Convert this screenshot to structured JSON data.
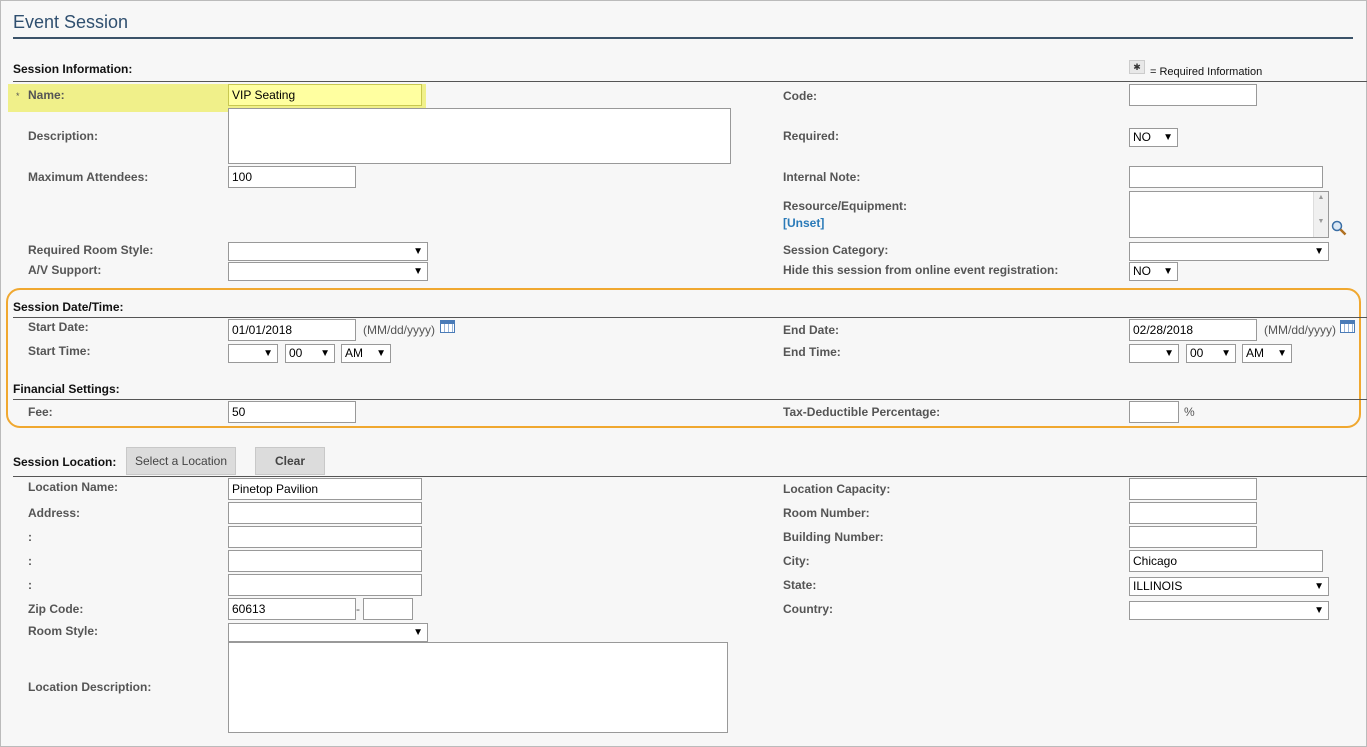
{
  "page": {
    "title": "Event Session"
  },
  "legend": {
    "text": "= Required Information",
    "icon": "required-asterisk-icon"
  },
  "session_info": {
    "heading": "Session Information:",
    "name": {
      "label": "Name:",
      "value": "VIP Seating",
      "required_mark": "*"
    },
    "description": {
      "label": "Description:",
      "value": ""
    },
    "max_attendees": {
      "label": "Maximum Attendees:",
      "value": "100"
    },
    "room_style": {
      "label": "Required Room Style:",
      "value": ""
    },
    "av_support": {
      "label": "A/V Support:",
      "value": ""
    },
    "code": {
      "label": "Code:",
      "value": ""
    },
    "required": {
      "label": "Required:",
      "value": "NO"
    },
    "internal_note": {
      "label": "Internal Note:",
      "value": ""
    },
    "resource": {
      "label": "Resource/Equipment:",
      "link": "[Unset]"
    },
    "category": {
      "label": "Session Category:",
      "value": ""
    },
    "hide": {
      "label": "Hide this session from online event registration:",
      "value": "NO"
    }
  },
  "datetime": {
    "heading": "Session Date/Time:",
    "start_date": {
      "label": "Start Date:",
      "value": "01/01/2018",
      "hint": "(MM/dd/yyyy)"
    },
    "start_time": {
      "label": "Start Time:",
      "hour": "",
      "minute": "00",
      "ampm": "AM"
    },
    "end_date": {
      "label": "End Date:",
      "value": "02/28/2018",
      "hint": "(MM/dd/yyyy)"
    },
    "end_time": {
      "label": "End Time:",
      "hour": "",
      "minute": "00",
      "ampm": "AM"
    }
  },
  "financial": {
    "heading": "Financial Settings:",
    "fee": {
      "label": "Fee:",
      "value": "50"
    },
    "tax": {
      "label": "Tax-Deductible Percentage:",
      "value": "",
      "unit": "%"
    }
  },
  "location": {
    "heading": "Session Location:",
    "select_button": "Select a Location",
    "clear_button": "Clear",
    "name": {
      "label": "Location Name:",
      "value": "Pinetop Pavilion"
    },
    "address": {
      "label": "Address:",
      "value": ""
    },
    "address2": {
      "label": ":",
      "value": ""
    },
    "address3": {
      "label": ":",
      "value": ""
    },
    "address4": {
      "label": ":",
      "value": ""
    },
    "zip": {
      "label": "Zip Code:",
      "value": "60613",
      "sep": "-",
      "ext": ""
    },
    "room_style": {
      "label": "Room Style:",
      "value": ""
    },
    "description": {
      "label": "Location Description:",
      "value": ""
    },
    "capacity": {
      "label": "Location Capacity:",
      "value": ""
    },
    "room_number": {
      "label": "Room Number:",
      "value": ""
    },
    "building_number": {
      "label": "Building Number:",
      "value": ""
    },
    "city": {
      "label": "City:",
      "value": "Chicago"
    },
    "state": {
      "label": "State:",
      "value": "ILLINOIS"
    },
    "country": {
      "label": "Country:",
      "value": ""
    }
  }
}
